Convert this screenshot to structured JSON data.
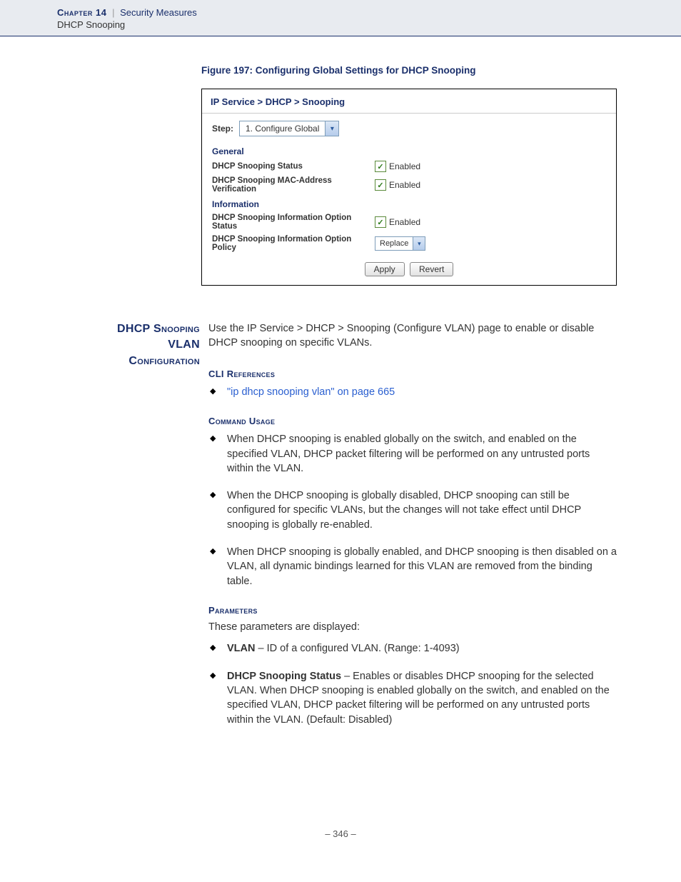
{
  "header": {
    "chapter": "Chapter 14",
    "separator": "|",
    "section": "Security Measures",
    "subsection": "DHCP Snooping"
  },
  "figure": {
    "caption": "Figure 197:  Configuring Global Settings for DHCP Snooping",
    "breadcrumb": "IP Service > DHCP > Snooping",
    "step_label": "Step:",
    "step_value": "1. Configure Global",
    "general_head": "General",
    "row_status": "DHCP Snooping Status",
    "row_mac": "DHCP Snooping MAC-Address Verification",
    "info_head": "Information",
    "row_opt_status": "DHCP Snooping Information Option Status",
    "row_opt_policy": "DHCP Snooping Information Option Policy",
    "enabled_label": "Enabled",
    "policy_value": "Replace",
    "apply": "Apply",
    "revert": "Revert"
  },
  "section": {
    "side_title_l1": "DHCP Snooping",
    "side_title_l2": "VLAN",
    "side_title_l3": "Configuration",
    "intro": "Use the IP Service > DHCP > Snooping (Configure VLAN) page to enable or disable DHCP snooping on specific VLANs.",
    "cli_head": "CLI References",
    "cli_link": "\"ip dhcp snooping vlan\" on page 665",
    "usage_head": "Command Usage",
    "usage": [
      "When DHCP snooping is enabled globally on the switch, and enabled on the specified VLAN, DHCP packet filtering will be performed on any untrusted ports within the VLAN.",
      "When the DHCP snooping is globally disabled, DHCP snooping can still be configured for specific VLANs, but the changes will not take effect until DHCP snooping is globally re-enabled.",
      "When DHCP snooping is globally enabled, and DHCP snooping is then disabled on a VLAN, all dynamic bindings learned for this VLAN are removed from the binding table."
    ],
    "params_head": "Parameters",
    "params_intro": "These parameters are displayed:",
    "param_vlan_name": "VLAN",
    "param_vlan_desc": " – ID of a configured VLAN. (Range: 1-4093)",
    "param_status_name": "DHCP Snooping Status",
    "param_status_desc": " – Enables or disables DHCP snooping for the selected VLAN. When DHCP snooping is enabled globally on the switch, and enabled on the specified VLAN, DHCP packet filtering will be performed on any untrusted ports within the VLAN. (Default: Disabled)"
  },
  "page_number": "–  346  –"
}
